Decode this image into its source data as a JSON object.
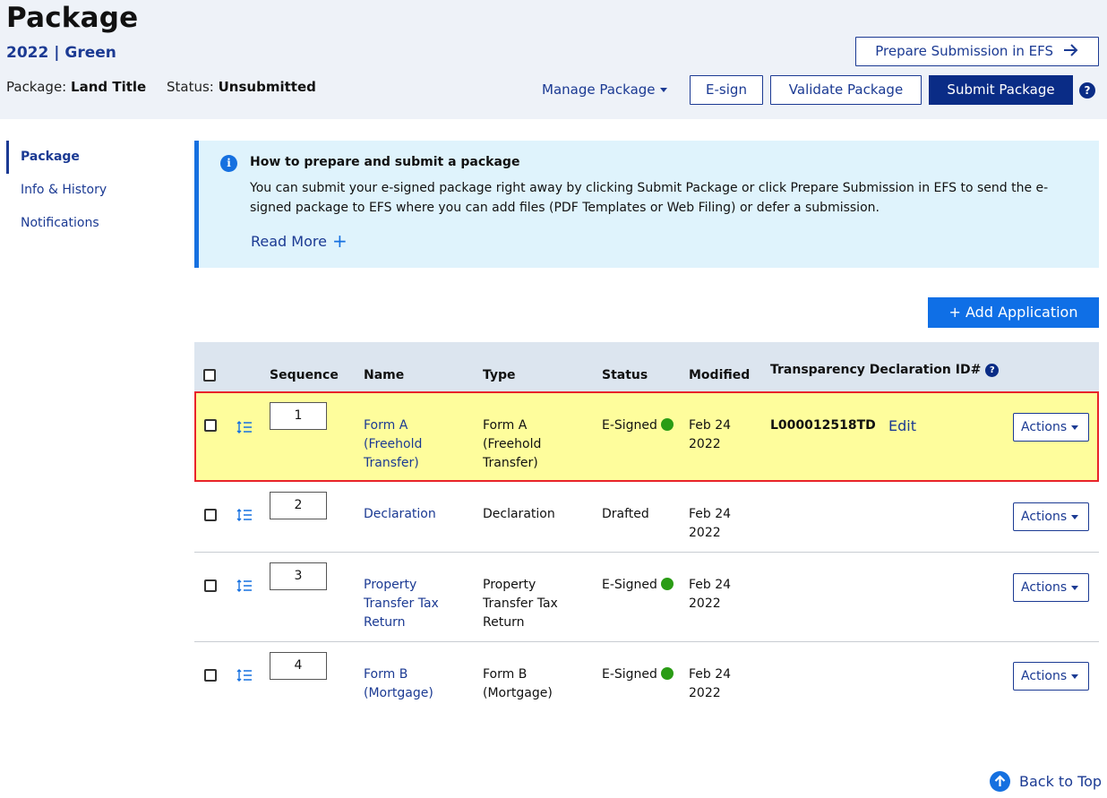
{
  "header": {
    "title": "Package",
    "subtitle": "2022 | Green",
    "package_label": "Package:",
    "package_value": "Land Title",
    "status_label": "Status:",
    "status_value": "Unsubmitted",
    "prepare_efs_label": "Prepare Submission in EFS",
    "manage_label": "Manage Package",
    "esign_label": "E-sign",
    "validate_label": "Validate Package",
    "submit_label": "Submit Package",
    "help_glyph": "?"
  },
  "sidebar": {
    "items": [
      {
        "label": "Package",
        "active": true
      },
      {
        "label": "Info & History",
        "active": false
      },
      {
        "label": "Notifications",
        "active": false
      }
    ]
  },
  "info": {
    "icon_glyph": "i",
    "title": "How to prepare and submit a package",
    "body": "You can submit your e-signed package right away by clicking Submit Package or click Prepare Submission in EFS to send the e-signed package to EFS where you can add files (PDF Templates or Web Filing) or defer a submission.",
    "read_more": "Read More",
    "plus": "+"
  },
  "add_application": "+ Add Application",
  "table": {
    "headers": {
      "sequence": "Sequence",
      "name": "Name",
      "type": "Type",
      "status": "Status",
      "modified": "Modified",
      "tdid": "Transparency Declaration ID#",
      "help_glyph": "?"
    },
    "rows": [
      {
        "sequence": "1",
        "name": "Form A (Freehold Transfer)",
        "type": "Form A (Freehold Transfer)",
        "status": "E-Signed",
        "status_dot": true,
        "modified": "Feb 24 2022",
        "tdid": "L000012518TD",
        "edit": "Edit",
        "actions": "Actions"
      },
      {
        "sequence": "2",
        "name": "Declaration",
        "type": "Declaration",
        "status": "Drafted",
        "status_dot": false,
        "modified": "Feb 24 2022",
        "tdid": "",
        "edit": "",
        "actions": "Actions"
      },
      {
        "sequence": "3",
        "name": "Property Transfer Tax Return",
        "type": "Property Transfer Tax Return",
        "status": "E-Signed",
        "status_dot": true,
        "modified": "Feb 24 2022",
        "tdid": "",
        "edit": "",
        "actions": "Actions"
      },
      {
        "sequence": "4",
        "name": "Form B (Mortgage)",
        "type": "Form B (Mortgage)",
        "status": "E-Signed",
        "status_dot": true,
        "modified": "Feb 24 2022",
        "tdid": "",
        "edit": "",
        "actions": "Actions"
      }
    ]
  },
  "back_to_top": "Back to Top",
  "colors": {
    "accent_navy": "#0a2c86",
    "accent_blue": "#1570e0",
    "highlight_row": "#fefd9c",
    "highlight_border": "#e8242a",
    "signed_green": "#2a9c15"
  }
}
